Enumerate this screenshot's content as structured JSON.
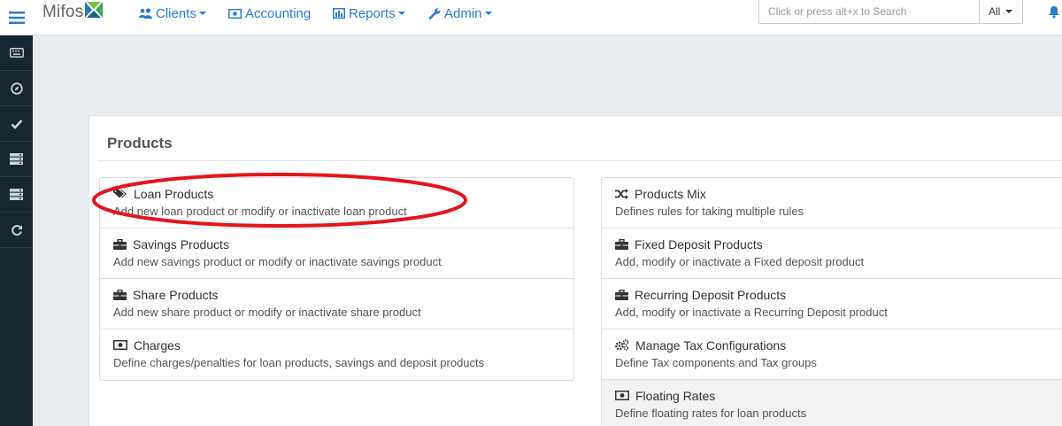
{
  "app": {
    "brand": "Mifos"
  },
  "navbar": {
    "items": [
      {
        "label": "Clients",
        "icon": "users-icon",
        "dropdown": true
      },
      {
        "label": "Accounting",
        "icon": "money-icon",
        "dropdown": false
      },
      {
        "label": "Reports",
        "icon": "bar-chart-icon",
        "dropdown": true
      },
      {
        "label": "Admin",
        "icon": "wrench-icon",
        "dropdown": true
      }
    ],
    "search": {
      "placeholder": "Click or press alt+x to Search",
      "value": ""
    },
    "search_scope": "All"
  },
  "sidebar": {
    "items": [
      {
        "icon": "keyboard-icon"
      },
      {
        "icon": "compass-icon"
      },
      {
        "icon": "check-icon"
      },
      {
        "icon": "server-icon"
      },
      {
        "icon": "server-icon"
      },
      {
        "icon": "refresh-icon"
      }
    ]
  },
  "main": {
    "title": "Products",
    "left_items": [
      {
        "title": "Loan Products",
        "description": "Add new loan product or modify or inactivate loan product",
        "icon": "tags-icon"
      },
      {
        "title": "Savings Products",
        "description": "Add new savings product or modify or inactivate savings product",
        "icon": "briefcase-icon"
      },
      {
        "title": "Share Products",
        "description": "Add new share product or modify or inactivate share product",
        "icon": "briefcase-icon"
      },
      {
        "title": "Charges",
        "description": "Define charges/penalties for loan products, savings and deposit products",
        "icon": "money-icon"
      }
    ],
    "right_items": [
      {
        "title": "Products Mix",
        "description": "Defines rules for taking multiple rules",
        "icon": "random-icon"
      },
      {
        "title": "Fixed Deposit Products",
        "description": "Add, modify or inactivate a Fixed deposit product",
        "icon": "briefcase-icon"
      },
      {
        "title": "Recurring Deposit Products",
        "description": "Add, modify or inactivate a Recurring Deposit product",
        "icon": "briefcase-icon"
      },
      {
        "title": "Manage Tax Configurations",
        "description": "Define Tax components and Tax groups",
        "icon": "cogs-icon"
      },
      {
        "title": "Floating Rates",
        "description": "Define floating rates for loan products",
        "icon": "money-icon"
      }
    ]
  },
  "colors": {
    "link": "#2b7bd1",
    "sidebar": "#16262e",
    "annotation": "#e8131b"
  }
}
